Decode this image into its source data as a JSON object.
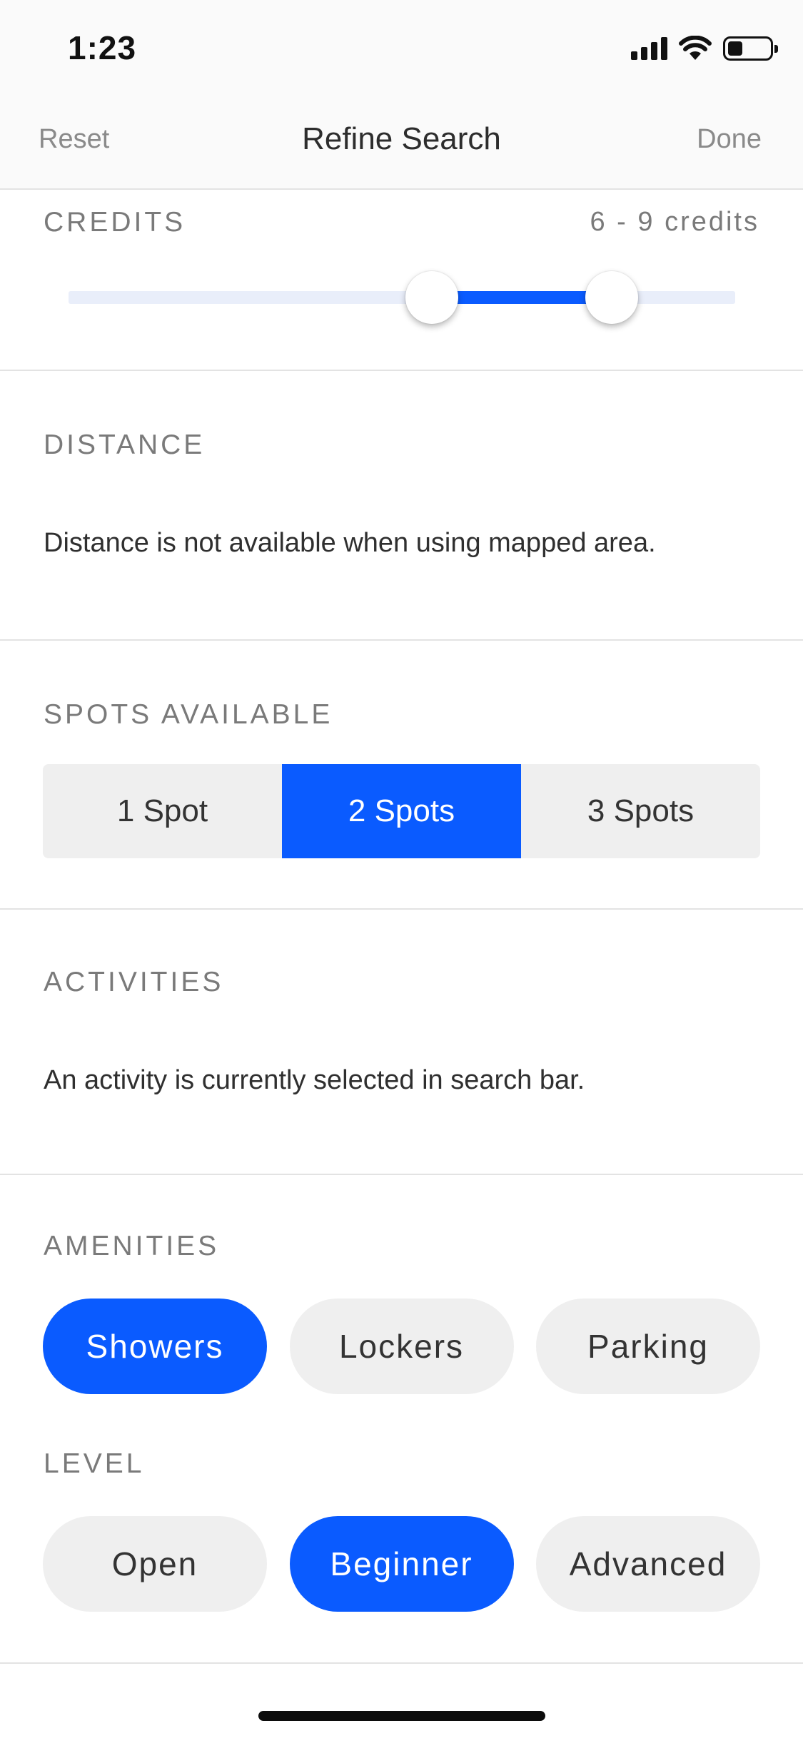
{
  "status_bar": {
    "time": "1:23",
    "icons": [
      "cellular-signal-icon",
      "wifi-icon",
      "battery-icon"
    ]
  },
  "nav": {
    "left_label": "Reset",
    "title": "Refine Search",
    "right_label": "Done"
  },
  "credits": {
    "label": "CREDITS",
    "value_text": "6 - 9 credits",
    "slider_low_fraction": 0.545,
    "slider_high_fraction": 0.815
  },
  "distance": {
    "label": "DISTANCE",
    "note": "Distance is not available when using mapped area."
  },
  "spots": {
    "label": "SPOTS AVAILABLE",
    "options": [
      "1 Spot",
      "2 Spots",
      "3 Spots"
    ],
    "selected": "2 Spots"
  },
  "activities": {
    "label": "ACTIVITIES",
    "note": "An activity is currently selected in search bar."
  },
  "amenities": {
    "label": "AMENITIES",
    "options": [
      "Showers",
      "Lockers",
      "Parking"
    ],
    "selected": [
      "Showers"
    ]
  },
  "level": {
    "label": "LEVEL",
    "options": [
      "Open",
      "Beginner",
      "Advanced"
    ],
    "selected": [
      "Beginner"
    ]
  },
  "colors": {
    "accent": "#0a5bff",
    "track": "#e9eefa",
    "chip_background": "#efefef",
    "label_gray": "#7a7a7a"
  }
}
